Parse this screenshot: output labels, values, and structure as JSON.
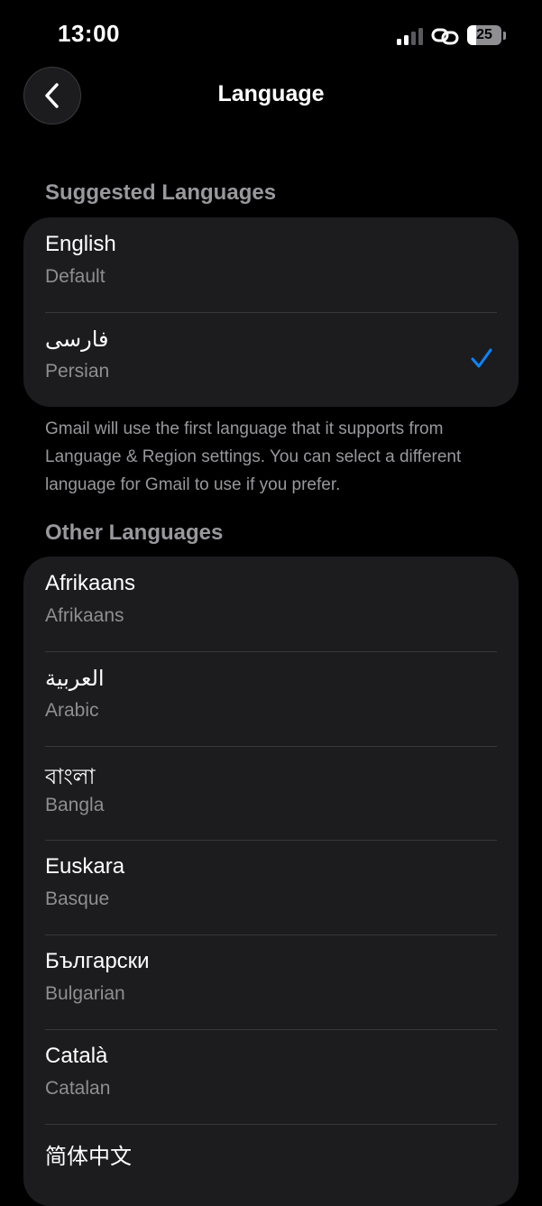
{
  "status_bar": {
    "time": "13:00",
    "battery_level": "25",
    "battery_fraction": 0.25,
    "icons": [
      "signal-icon",
      "link-icon",
      "battery-icon"
    ]
  },
  "nav": {
    "title": "Language",
    "back_icon": "chevron-left-icon"
  },
  "suggested": {
    "header": "Suggested Languages",
    "items": [
      {
        "native": "English",
        "english": "Default",
        "selected": false
      },
      {
        "native": "فارسی",
        "english": "Persian",
        "selected": true
      }
    ]
  },
  "footer": "Gmail will use the first language that it supports from Language & Region settings. You can select a different language for Gmail to use if you prefer.",
  "other": {
    "header": "Other Languages",
    "items": [
      {
        "native": "Afrikaans",
        "english": "Afrikaans"
      },
      {
        "native": "العربية",
        "english": "Arabic"
      },
      {
        "native": "বাংলা",
        "english": "Bangla"
      },
      {
        "native": "Euskara",
        "english": "Basque"
      },
      {
        "native": "Български",
        "english": "Bulgarian"
      },
      {
        "native": "Català",
        "english": "Catalan"
      },
      {
        "native": "简体中文",
        "english": ""
      }
    ]
  },
  "colors": {
    "background": "#000000",
    "cell": "#1c1c1e",
    "accent": "#0a84ff",
    "secondary_text": "#8e8e93"
  }
}
